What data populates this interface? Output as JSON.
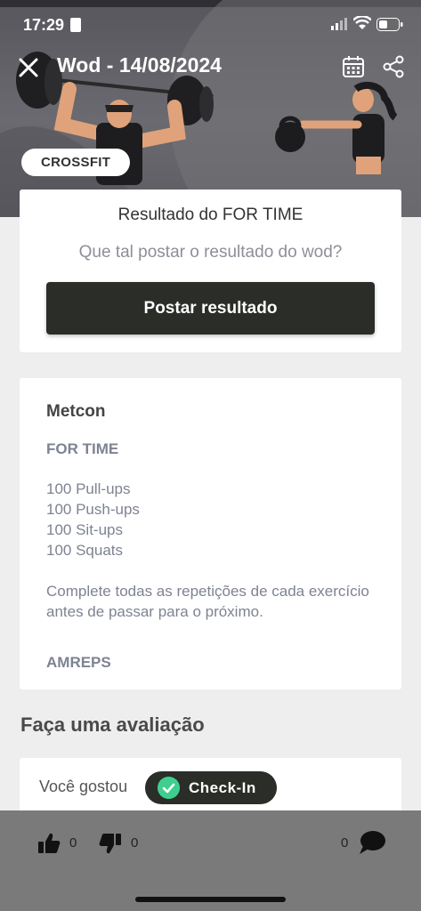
{
  "status_bar": {
    "time": "17:29"
  },
  "header": {
    "title": "Wod - 14/08/2024",
    "category_tag": "CROSSFIT",
    "icons": [
      "close-icon",
      "calendar-icon",
      "share-icon"
    ]
  },
  "result_card": {
    "title": "Resultado do FOR TIME",
    "prompt": "Que tal postar o resultado do wod?",
    "button_label": "Postar resultado"
  },
  "metcon_card": {
    "title": "Metcon",
    "type": "FOR TIME",
    "exercises": [
      "100 Pull-ups",
      "100 Push-ups",
      "100 Sit-ups",
      "100 Squats"
    ],
    "description": "Complete todas as repetições de cada exercício antes de passar para o próximo.",
    "footer": "AMREPS"
  },
  "review": {
    "section_title": "Faça uma avaliação",
    "question": "Você gostou"
  },
  "checkin_button": {
    "label": "Check-In",
    "accent": "#3ecf8e"
  },
  "bottom_bar": {
    "likes": "0",
    "dislikes": "0",
    "comments": "0"
  },
  "colors": {
    "primary_dark": "#2b2d29",
    "muted_text": "#7e8392",
    "background": "#eeeeee"
  }
}
